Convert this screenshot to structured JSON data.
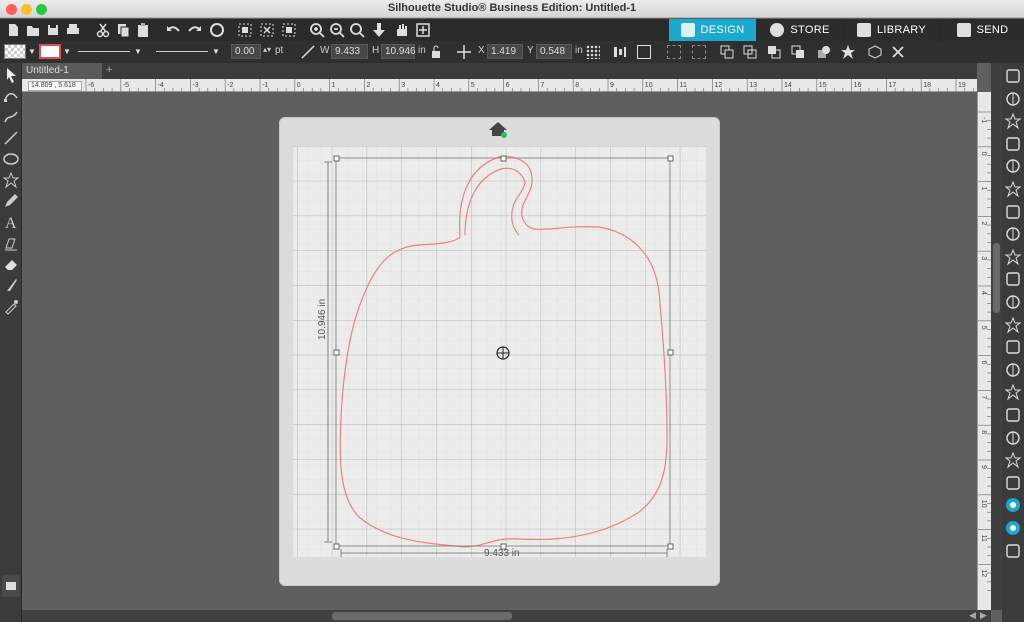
{
  "window": {
    "title": "Silhouette Studio® Business Edition: Untitled-1"
  },
  "tabs": [
    {
      "label": "DESIGN",
      "color": "#1aa9cf",
      "active": true
    },
    {
      "label": "STORE",
      "color": "#2c2c2c",
      "active": false
    },
    {
      "label": "LIBRARY",
      "color": "#2c2c2c",
      "active": false
    },
    {
      "label": "SEND",
      "color": "#2c2c2c",
      "active": false
    }
  ],
  "options": {
    "line_width_value": "0.00",
    "line_width_unit": "pt",
    "width_label": "W",
    "width_value": "9.433",
    "height_label": "H",
    "height_value": "10.946",
    "size_unit": "in",
    "x_label": "X",
    "x_value": "1.419",
    "y_label": "Y",
    "y_value": "0.548",
    "pos_unit": "in"
  },
  "document": {
    "tab_label": "Untitled-1",
    "add_tab": "+",
    "coordinate_readout": "14.809 , 5.618"
  },
  "ruler": {
    "horizontal_ticks": [
      "-6",
      "-5",
      "-4",
      "-3",
      "-2",
      "-1",
      "0",
      "1",
      "2",
      "3",
      "4",
      "5",
      "6",
      "7",
      "8",
      "9",
      "10",
      "11",
      "12",
      "13",
      "14",
      "15",
      "16",
      "17",
      "18",
      "19"
    ],
    "vertical_ticks": [
      "-1",
      "0",
      "1",
      "2",
      "3",
      "4",
      "5",
      "6",
      "7",
      "8",
      "9",
      "10",
      "11",
      "12"
    ]
  },
  "selection": {
    "height_label": "10.946 in",
    "width_label": "9.433 in"
  },
  "colors": {
    "accent": "#1aa9cf",
    "cut_line": "#f08080",
    "selection_handle": "#ffffff"
  },
  "icons": {
    "main_toolbar": [
      "new-file-icon",
      "open-file-icon",
      "save-icon",
      "print-icon",
      "cut-icon",
      "copy-icon",
      "paste-icon",
      "undo-icon",
      "redo-icon",
      "redraw-icon",
      "select-all-icon",
      "deselect-icon",
      "delete-icon",
      "zoom-in-icon",
      "zoom-out-icon",
      "zoom-fit-icon",
      "move-down-icon",
      "pan-hand-icon",
      "add-page-icon"
    ],
    "left_tools": [
      "pointer-icon",
      "node-edit-icon",
      "draw-curve-icon",
      "line-icon",
      "ellipse-icon",
      "star-icon",
      "pencil-icon",
      "text-icon",
      "fill-icon",
      "eraser-icon",
      "knife-icon",
      "eyedropper-icon"
    ],
    "right_panel": [
      "page-setup-icon",
      "fill-color-icon",
      "line-style-icon",
      "transform-icon",
      "shadow-icon",
      "text-style-icon",
      "font-icon",
      "align-icon",
      "replicate-icon",
      "modify-icon",
      "offset-icon",
      "trace-icon",
      "sketch-icon",
      "rhinestone-icon",
      "star-panel-icon",
      "puzzle-icon",
      "layers-icon",
      "pattern-icon",
      "library-icon",
      "settings-icon",
      "send-icon",
      "grid-icon"
    ]
  }
}
